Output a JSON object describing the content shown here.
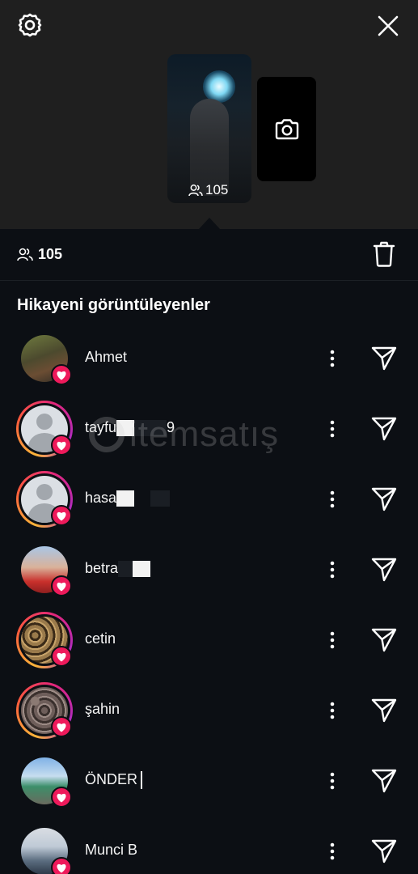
{
  "header": {
    "settings_icon": "gear-icon",
    "close_icon": "close-icon"
  },
  "story": {
    "views": "105",
    "camera_icon": "camera-icon"
  },
  "viewers_summary": {
    "count": "105",
    "delete_icon": "trash-icon"
  },
  "section_title": "Hikayeni görüntüleyenler",
  "viewers": [
    {
      "name": "Ahmet",
      "avatar": "photo",
      "liked": true,
      "has_story_ring": false
    },
    {
      "name": "tayfu",
      "name_suffix": "9",
      "avatar": "default",
      "liked": true,
      "has_story_ring": true
    },
    {
      "name": "hasa",
      "avatar": "default",
      "liked": true,
      "has_story_ring": true
    },
    {
      "name": "betra",
      "avatar": "photo",
      "liked": true,
      "has_story_ring": false
    },
    {
      "name": "cetin",
      "avatar": "photo",
      "liked": true,
      "has_story_ring": true
    },
    {
      "name": "şahin",
      "avatar": "photo",
      "liked": true,
      "has_story_ring": true
    },
    {
      "name": "ÖNDER",
      "avatar": "photo",
      "liked": true,
      "has_story_ring": false
    },
    {
      "name": "Munci B",
      "avatar": "photo",
      "liked": true,
      "has_story_ring": false
    }
  ],
  "watermark": "itemsatış",
  "colors": {
    "background": "#0c0f14",
    "top_panel": "#1f1f1f",
    "heart": "#ee1a5b",
    "ring_start": "#fbb53a",
    "ring_end": "#b12bbf"
  }
}
